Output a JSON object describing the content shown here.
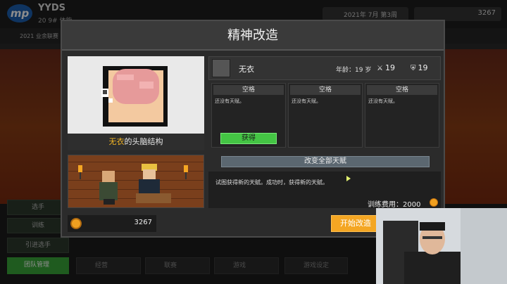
{
  "header": {
    "logo_text": "mp",
    "team_name": "YYDS",
    "team_sub": "20 9# 体能",
    "date": "2021年 7月 第3周",
    "money": "3267",
    "league_label": "2021 业余联赛"
  },
  "sidebar": {
    "items": [
      {
        "label": "选手"
      },
      {
        "label": "训练"
      },
      {
        "label": "引进选手"
      }
    ]
  },
  "bottom_nav": [
    {
      "label": "团队管理"
    },
    {
      "label": "经营"
    },
    {
      "label": "联赛"
    },
    {
      "label": "游戏"
    },
    {
      "label": "游戏设定"
    }
  ],
  "modal": {
    "title": "精神改造",
    "brain_caption_name": "无衣",
    "brain_caption_suffix": "的头脑结构",
    "player": {
      "name": "无衣",
      "age": "年龄：19 岁",
      "attack": "19",
      "defense": "19"
    },
    "slots": [
      {
        "title": "空格",
        "desc": "还没有天赋。"
      },
      {
        "title": "空格",
        "desc": "还没有天赋。"
      },
      {
        "title": "空格",
        "desc": "还没有天赋。"
      }
    ],
    "acquire_label": "获得",
    "change_all_label": "改变全部天赋",
    "info_text": "试图获得新的天赋。成功时，获得新的天赋。",
    "cost_label": "训练费用：2000",
    "money": "3267",
    "start_label": "开始改造"
  },
  "colors": {
    "accent_yellow": "#f4b624",
    "acquire_green": "#44c544",
    "start_orange": "#f4a623",
    "coin_gold": "#f0a020"
  }
}
